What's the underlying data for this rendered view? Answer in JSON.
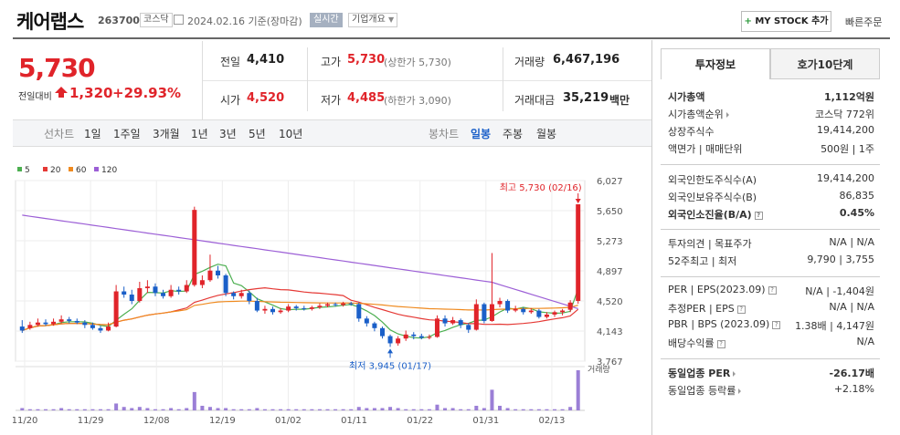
{
  "header": {
    "stock_name": "케어랩스",
    "stock_code": "263700",
    "market": "코스닥",
    "date": "2024.02.16 기준(장마감)",
    "realtime_label": "실시간",
    "company_label": "기업개요",
    "mystock_label": "MY STOCK 추가",
    "quick_order_label": "빠른주문"
  },
  "price": {
    "current": "5,730",
    "prev_label": "전일대비",
    "change": "1,320",
    "change_pct": "+29.93%"
  },
  "summary": {
    "prev_close_label": "전일",
    "prev_close": "4,410",
    "open_label": "시가",
    "open": "4,520",
    "high_label": "고가",
    "high": "5,730",
    "upper_limit": "(상한가 5,730)",
    "low_label": "저가",
    "low": "4,485",
    "lower_limit": "(하한가 3,090)",
    "volume_label": "거래량",
    "volume": "6,467,196",
    "amount_label": "거래대금",
    "amount": "35,219",
    "amount_unit": "백만"
  },
  "periods": {
    "line_label": "선차트",
    "line_items": [
      "1일",
      "1주일",
      "3개월",
      "1년",
      "3년",
      "5년",
      "10년"
    ],
    "candle_label": "봉차트",
    "candle_items": [
      "일봉",
      "주봉",
      "월봉"
    ],
    "candle_selected": "일봉"
  },
  "chart_data": {
    "type": "candlestick",
    "legend": [
      {
        "name": "5",
        "color": "#4caf50"
      },
      {
        "name": "20",
        "color": "#e53935"
      },
      {
        "name": "60",
        "color": "#ef8a1f"
      },
      {
        "name": "120",
        "color": "#9c5fd6"
      }
    ],
    "y_ticks": [
      "6,027",
      "5,650",
      "5,273",
      "4,897",
      "4,520",
      "4,143",
      "3,767"
    ],
    "ylim": [
      3767,
      6027
    ],
    "x_ticks": [
      "11/20",
      "11/29",
      "12/08",
      "12/19",
      "01/02",
      "01/11",
      "01/22",
      "01/31",
      "02/13"
    ],
    "high_annotation": "최고 5,730 (02/16)",
    "low_annotation": "최저 3,945 (01/17)",
    "volume_label": "거래량",
    "candles": [
      [
        4200,
        4150,
        4280,
        4120
      ],
      [
        4180,
        4220,
        4260,
        4160
      ],
      [
        4220,
        4250,
        4300,
        4200
      ],
      [
        4250,
        4230,
        4290,
        4210
      ],
      [
        4230,
        4260,
        4300,
        4210
      ],
      [
        4260,
        4290,
        4340,
        4240
      ],
      [
        4290,
        4270,
        4320,
        4240
      ],
      [
        4270,
        4250,
        4300,
        4230
      ],
      [
        4250,
        4220,
        4280,
        4180
      ],
      [
        4220,
        4180,
        4250,
        4160
      ],
      [
        4180,
        4150,
        4210,
        4120
      ],
      [
        4150,
        4200,
        4250,
        4140
      ],
      [
        4200,
        4640,
        4720,
        4190
      ],
      [
        4640,
        4600,
        4700,
        4560
      ],
      [
        4600,
        4520,
        4660,
        4480
      ],
      [
        4520,
        4680,
        4760,
        4500
      ],
      [
        4680,
        4700,
        4780,
        4620
      ],
      [
        4700,
        4620,
        4740,
        4580
      ],
      [
        4620,
        4580,
        4660,
        4550
      ],
      [
        4580,
        4660,
        4720,
        4560
      ],
      [
        4660,
        4640,
        4700,
        4600
      ],
      [
        4640,
        4720,
        4780,
        4620
      ],
      [
        4720,
        5660,
        5700,
        4700
      ],
      [
        4720,
        4780,
        4840,
        4680
      ],
      [
        4780,
        4900,
        5100,
        4760
      ],
      [
        4900,
        4840,
        4960,
        4800
      ],
      [
        4840,
        4620,
        4860,
        4580
      ],
      [
        4620,
        4580,
        4640,
        4540
      ],
      [
        4580,
        4620,
        4660,
        4550
      ],
      [
        4620,
        4520,
        4650,
        4480
      ],
      [
        4520,
        4400,
        4560,
        4380
      ],
      [
        4400,
        4420,
        4460,
        4360
      ],
      [
        4420,
        4380,
        4450,
        4350
      ],
      [
        4380,
        4400,
        4430,
        4360
      ],
      [
        4400,
        4450,
        4480,
        4380
      ],
      [
        4450,
        4430,
        4470,
        4400
      ],
      [
        4430,
        4420,
        4460,
        4400
      ],
      [
        4420,
        4440,
        4460,
        4400
      ],
      [
        4440,
        4460,
        4490,
        4420
      ],
      [
        4460,
        4480,
        4500,
        4440
      ],
      [
        4480,
        4470,
        4500,
        4450
      ],
      [
        4470,
        4490,
        4510,
        4450
      ],
      [
        4490,
        4480,
        4510,
        4460
      ],
      [
        4480,
        4300,
        4500,
        4260
      ],
      [
        4300,
        4240,
        4330,
        4200
      ],
      [
        4240,
        4180,
        4260,
        4140
      ],
      [
        4180,
        4080,
        4200,
        4050
      ],
      [
        4080,
        3990,
        4100,
        3945
      ],
      [
        3990,
        4050,
        4080,
        3960
      ],
      [
        4050,
        4100,
        4150,
        4020
      ],
      [
        4100,
        4080,
        4130,
        4040
      ],
      [
        4080,
        4060,
        4110,
        4040
      ],
      [
        4060,
        4070,
        4100,
        4040
      ],
      [
        4070,
        4300,
        4340,
        4060
      ],
      [
        4300,
        4240,
        4340,
        4200
      ],
      [
        4240,
        4280,
        4320,
        4220
      ],
      [
        4280,
        4220,
        4300,
        4180
      ],
      [
        4220,
        4160,
        4240,
        4120
      ],
      [
        4160,
        4480,
        4540,
        4150
      ],
      [
        4480,
        4270,
        4500,
        4240
      ],
      [
        4270,
        4480,
        5120,
        4260
      ],
      [
        4480,
        4520,
        4560,
        4440
      ],
      [
        4520,
        4400,
        4540,
        4370
      ],
      [
        4400,
        4420,
        4460,
        4380
      ],
      [
        4420,
        4380,
        4440,
        4350
      ],
      [
        4380,
        4400,
        4430,
        4360
      ],
      [
        4400,
        4320,
        4420,
        4300
      ],
      [
        4320,
        4350,
        4380,
        4300
      ],
      [
        4350,
        4380,
        4400,
        4320
      ],
      [
        4380,
        4400,
        4420,
        4340
      ],
      [
        4410,
        4500,
        4530,
        4380
      ],
      [
        4520,
        5730,
        5730,
        4485
      ]
    ],
    "volumes": [
      2,
      1,
      1,
      1,
      1,
      2,
      1,
      1,
      1,
      1,
      1,
      1,
      6,
      3,
      2,
      3,
      2,
      1,
      1,
      2,
      1,
      2,
      16,
      4,
      3,
      2,
      2,
      1,
      1,
      1,
      2,
      1,
      1,
      1,
      1,
      1,
      1,
      1,
      1,
      1,
      1,
      1,
      1,
      3,
      2,
      2,
      2,
      3,
      2,
      1,
      1,
      1,
      1,
      5,
      2,
      2,
      1,
      1,
      4,
      2,
      18,
      4,
      2,
      1,
      1,
      1,
      1,
      1,
      1,
      1,
      3,
      35
    ]
  },
  "right_panel": {
    "tab_info": "투자정보",
    "tab_ask": "호가10단계",
    "rows": [
      {
        "k": "시가총액",
        "v": "1,112억원"
      },
      {
        "k": "시가총액순위",
        "v": "코스닥 772위"
      },
      {
        "k": "상장주식수",
        "v": "19,414,200"
      },
      {
        "k": "액면가 | 매매단위",
        "v": "500원 | 1주"
      },
      {
        "k": "외국인한도주식수(A)",
        "v": "19,414,200"
      },
      {
        "k": "외국인보유주식수(B)",
        "v": "86,835"
      },
      {
        "k": "외국인소진율(B/A)",
        "v": "0.45%"
      },
      {
        "k": "투자의견 | 목표주가",
        "v": "N/A | N/A"
      },
      {
        "k": "52주최고 | 최저",
        "v": "9,790 | 3,755"
      },
      {
        "k": "PER | EPS(2023.09)",
        "v": "N/A | -1,404원"
      },
      {
        "k": "추정PER | EPS",
        "v": "N/A | N/A"
      },
      {
        "k": "PBR | BPS (2023.09)",
        "v": "1.38배 | 4,147원"
      },
      {
        "k": "배당수익률",
        "v": "N/A"
      },
      {
        "k": "동일업종 PER",
        "v": "-26.17배"
      },
      {
        "k": "동일업종 등락률",
        "v": "+2.18%"
      }
    ]
  }
}
